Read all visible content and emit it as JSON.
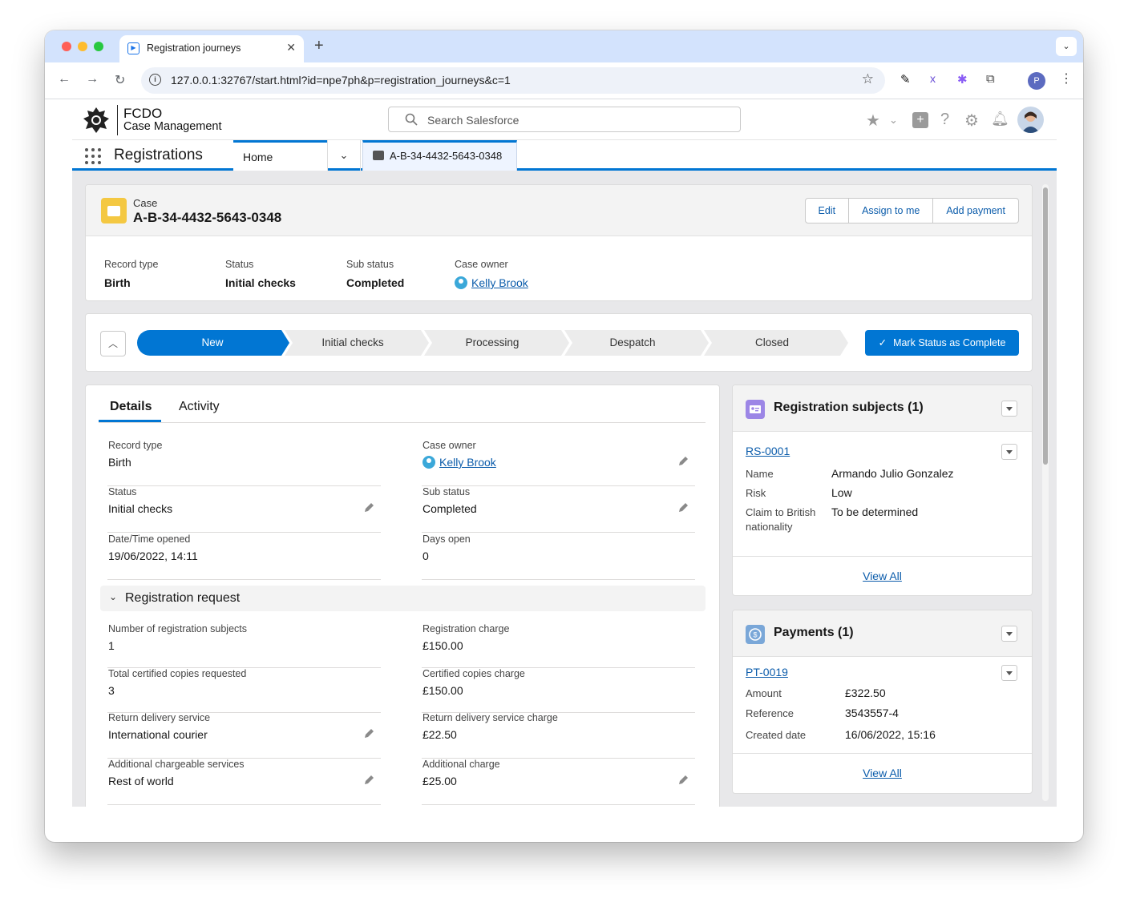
{
  "browser": {
    "tab_title": "Registration journeys",
    "url": "127.0.0.1:32767/start.html?id=npe7ph&p=registration_journeys&c=1",
    "profile_initial": "P"
  },
  "header": {
    "logo_line1": "FCDO",
    "logo_line2": "Case Management",
    "search_placeholder": "Search Salesforce"
  },
  "nav": {
    "app_name": "Registrations",
    "home_tab": "Home",
    "case_tab": "A-B-34-4432-5643-0348"
  },
  "case": {
    "object_label": "Case",
    "number": "A-B-34-4432-5643-0348",
    "actions": [
      "Edit",
      "Assign to me",
      "Add payment"
    ],
    "highlights": [
      {
        "label": "Record type",
        "value": "Birth"
      },
      {
        "label": "Status",
        "value": "Initial checks"
      },
      {
        "label": "Sub status",
        "value": "Completed"
      },
      {
        "label": "Case owner",
        "value": "Kelly Brook"
      }
    ]
  },
  "path": {
    "stages": [
      "New",
      "Initial checks",
      "Processing",
      "Despatch",
      "Closed"
    ],
    "current": "New",
    "button": "Mark Status as Complete"
  },
  "details": {
    "tabs": [
      "Details",
      "Activity"
    ],
    "fields": [
      {
        "label": "Record type",
        "value": "Birth"
      },
      {
        "label": "Case owner",
        "value": "Kelly Brook"
      },
      {
        "label": "Status",
        "value": "Initial checks"
      },
      {
        "label": "Sub status",
        "value": "Completed"
      },
      {
        "label": "Date/Time opened",
        "value": "19/06/2022, 14:11"
      },
      {
        "label": "Days open",
        "value": "0"
      }
    ],
    "section_title": "Registration request",
    "request_fields": [
      {
        "label": "Number of registration subjects",
        "value": "1"
      },
      {
        "label": "Registration charge",
        "value": "£150.00"
      },
      {
        "label": "Total certified copies requested",
        "value": "3"
      },
      {
        "label": "Certified copies charge",
        "value": "£150.00"
      },
      {
        "label": "Return delivery service",
        "value": "International courier"
      },
      {
        "label": "Return delivery service charge",
        "value": "£22.50"
      },
      {
        "label": "Additional chargeable services",
        "value": "Rest of world"
      },
      {
        "label": "Additional charge",
        "value": "£25.00"
      }
    ]
  },
  "subjects": {
    "title": "Registration subjects (1)",
    "record": "RS-0001",
    "rows": [
      {
        "label": "Name",
        "value": "Armando Julio Gonzalez"
      },
      {
        "label": "Risk",
        "value": "Low"
      },
      {
        "label": "Claim to British nationality",
        "value": "To be determined"
      }
    ],
    "view_all": "View All"
  },
  "payments": {
    "title": "Payments (1)",
    "record": "PT-0019",
    "rows": [
      {
        "label": "Amount",
        "value": "£322.50"
      },
      {
        "label": "Reference",
        "value": "3543557-4"
      },
      {
        "label": "Created date",
        "value": "16/06/2022, 15:16"
      }
    ],
    "view_all": "View All"
  },
  "colors": {
    "brand": "#0176d3",
    "case_icon": "#f4c842",
    "subjects_icon": "#9c86e6",
    "payments_icon": "#7aa7d8"
  }
}
